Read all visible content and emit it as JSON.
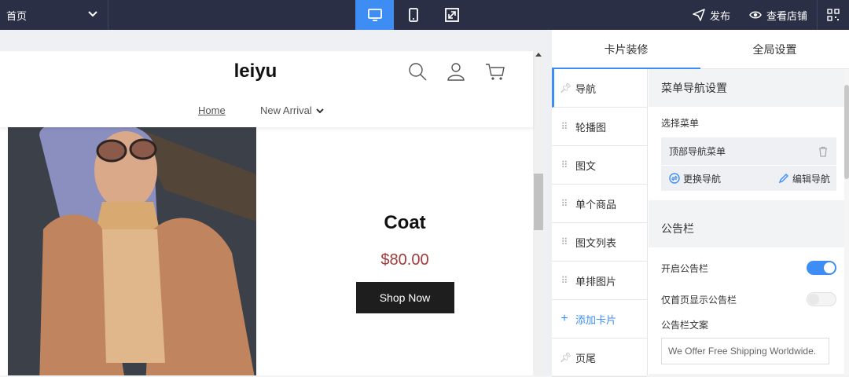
{
  "topbar": {
    "page_select": "首页",
    "publish": "发布",
    "view_store": "查看店铺",
    "devices": [
      "desktop-icon",
      "mobile-icon",
      "fullscreen-icon"
    ]
  },
  "store": {
    "logo": "leiyu",
    "nav": {
      "home": "Home",
      "new_arrival": "New Arrival"
    },
    "product": {
      "title": "Coat",
      "price": "$80.00",
      "button": "Shop Now"
    }
  },
  "panel": {
    "tabs": [
      "卡片装修",
      "全局设置"
    ],
    "cards": {
      "nav": "导航",
      "carousel": "轮播图",
      "image_text": "图文",
      "single_product": "单个商品",
      "image_text_list": "图文列表",
      "single_row_image": "单排图片",
      "add_card": "添加卡片",
      "footer": "页尾"
    },
    "menu_settings": {
      "title": "菜单导航设置",
      "select_label": "选择菜单",
      "selected_menu": "顶部导航菜单",
      "change": "更换导航",
      "edit": "编辑导航"
    },
    "announcement": {
      "title": "公告栏",
      "enable_label": "开启公告栏",
      "enable_on": true,
      "home_only_label": "仅首页显示公告栏",
      "home_only_on": false,
      "text_label": "公告栏文案",
      "text_value": "We Offer Free Shipping Worldwide."
    }
  },
  "colors": {
    "accent": "#3e8df4",
    "topbar": "#2b2f45",
    "price": "#a33a3a"
  }
}
